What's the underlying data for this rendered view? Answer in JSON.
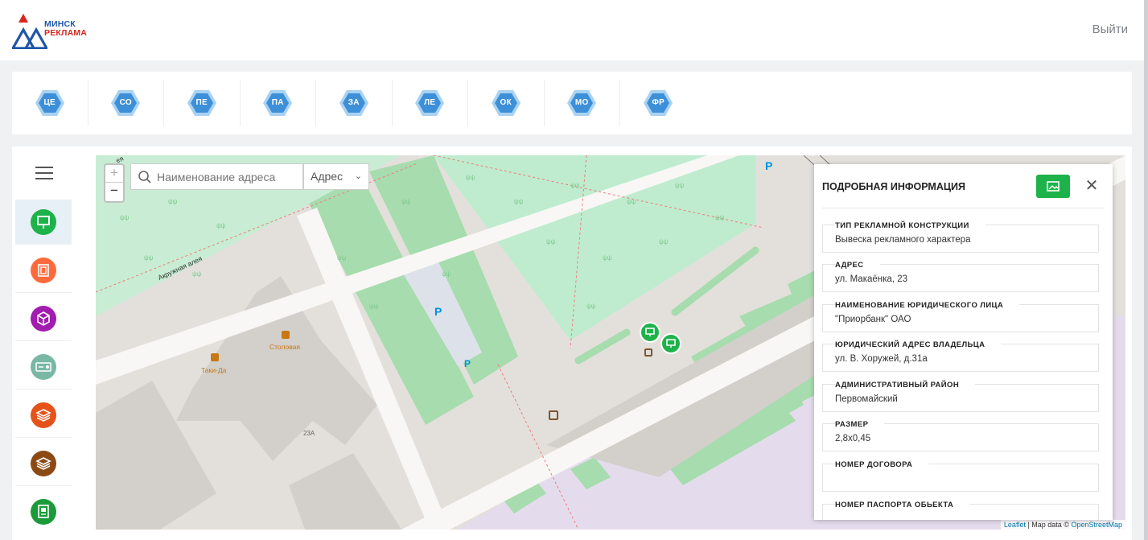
{
  "header": {
    "logo": {
      "line1": "МИНСК",
      "line2": "РЕКЛАМА"
    },
    "logout_label": "Выйти"
  },
  "districts": [
    {
      "label": "ЦЕ"
    },
    {
      "label": "СО"
    },
    {
      "label": "ПЕ"
    },
    {
      "label": "ПА"
    },
    {
      "label": "ЗА"
    },
    {
      "label": "ЛЕ"
    },
    {
      "label": "ОК"
    },
    {
      "label": "МО"
    },
    {
      "label": "ФР"
    }
  ],
  "colors": {
    "district_hex": "#3d8fd8",
    "district_hex_light": "#a9d2f2",
    "accent_green": "#1eb24b",
    "park": "#c8f0d6",
    "grass": "#a7e0b0"
  },
  "sidebar": {
    "menu_icon": "hamburger-icon",
    "categories": [
      {
        "name": "billboard-icon",
        "color": "#1eb24b",
        "active": true
      },
      {
        "name": "lightbox-icon",
        "color": "#ff6a3d",
        "active": false
      },
      {
        "name": "cube-icon",
        "color": "#a21caf",
        "active": false
      },
      {
        "name": "screen-icon",
        "color": "#7ab8a6",
        "active": false
      },
      {
        "name": "layers-icon",
        "color": "#e5531a",
        "active": false
      },
      {
        "name": "stack-icon",
        "color": "#8b4a15",
        "active": false
      },
      {
        "name": "panel-icon",
        "color": "#1a9b3a",
        "active": false
      }
    ]
  },
  "map": {
    "search": {
      "placeholder": "Наименование адреса"
    },
    "select": {
      "value": "Адрес"
    },
    "zoom_in": "+",
    "zoom_out": "−",
    "labels": {
      "street": "Акружная алея",
      "street_top": "ея",
      "cafe": "Таки-Да",
      "canteen": "Столовая",
      "building": "23А",
      "parking": "P"
    },
    "attribution": {
      "leaflet": "Leaflet",
      "sep": " | Map data © ",
      "osm": "OpenStreetMap"
    }
  },
  "info_panel": {
    "title": "ПОДРОБНАЯ ИНФОРМАЦИЯ",
    "close": "✕",
    "fields": [
      {
        "label": "ТИП РЕКЛАМНОЙ КОНСТРУКЦИИ",
        "value": "Вывеска рекламного характера"
      },
      {
        "label": "АДРЕС",
        "value": "ул. Макаёнка, 23"
      },
      {
        "label": "НАИМЕНОВАНИЕ ЮРИДИЧЕСКОГО ЛИЦА",
        "value": "\"Приорбанк\" ОАО"
      },
      {
        "label": "ЮРИДИЧЕСКИЙ АДРЕС ВЛАДЕЛЬЦА",
        "value": "ул. В. Хоружей, д.31а"
      },
      {
        "label": "АДМИНИСТРАТИВНЫЙ РАЙОН",
        "value": "Первомайский"
      },
      {
        "label": "РАЗМЕР",
        "value": "2,8х0,45"
      },
      {
        "label": "НОМЕР ДОГОВОРА",
        "value": ""
      },
      {
        "label": "НОМЕР ПАСПОРТА ОБЬЕКТА",
        "value": ""
      }
    ]
  }
}
